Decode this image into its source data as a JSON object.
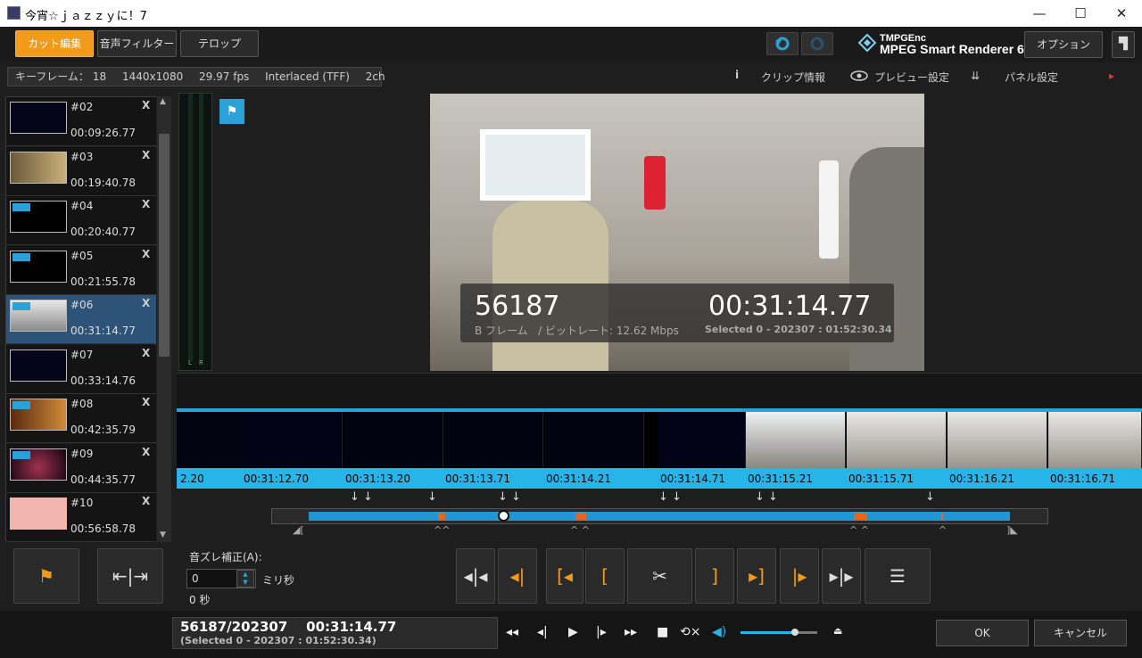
{
  "window": {
    "title": "今宵☆ｊａｚｚｙに！7",
    "minimize": "—",
    "maximize": "☐",
    "close": "✕"
  },
  "tabs": [
    {
      "label": "カット編集"
    },
    {
      "label": "音声フィルター"
    },
    {
      "label": "テロップ"
    }
  ],
  "brand": {
    "line1": "TMPGEnc",
    "line2": "MPEG Smart Renderer 6"
  },
  "options_label": "オプション",
  "info": {
    "keyframe_label": "キーフレーム：",
    "keyframe_value": "18",
    "resolution": "1440x1080",
    "fps": "29.97 fps",
    "scan": "Interlaced (TFF)",
    "audio": "2ch"
  },
  "right_links": {
    "clip_info": "クリップ情報",
    "preview_settings": "プレビュー設定",
    "panel_settings": "パネル設定"
  },
  "clips": [
    {
      "num": "#02",
      "time": "00:09:26.77"
    },
    {
      "num": "#03",
      "time": "00:19:40.78"
    },
    {
      "num": "#04",
      "time": "00:20:40.77"
    },
    {
      "num": "#05",
      "time": "00:21:55.78"
    },
    {
      "num": "#06",
      "time": "00:31:14.77"
    },
    {
      "num": "#07",
      "time": "00:33:14.76"
    },
    {
      "num": "#08",
      "time": "00:42:35.79"
    },
    {
      "num": "#09",
      "time": "00:44:35.77"
    },
    {
      "num": "#10",
      "time": "00:56:58.78"
    }
  ],
  "clip_remove": "X",
  "overlay": {
    "frame": "56187",
    "frame_type": "B フレーム",
    "bitrate": "/ ビットレート: 12.62 Mbps",
    "time": "00:31:14.77",
    "selected": "Selected 0 - 202307 : 01:52:30.34"
  },
  "meter_labels": {
    "l": "L",
    "r": "R"
  },
  "filmstrip_timecodes": [
    "2.20",
    "00:31:12.70",
    "00:31:13.20",
    "00:31:13.71",
    "00:31:14.21",
    "00:31:14.71",
    "00:31:15.21",
    "00:31:15.71",
    "00:31:16.21",
    "00:31:16.71"
  ],
  "audio_sync": {
    "label": "音ズレ補正(A):",
    "value": "0",
    "unit": "ミリ秒",
    "seconds": "0 秒"
  },
  "status": {
    "line1": "56187/202307    00:31:14.77",
    "line2": "(Selected 0 - 202307 : 01:52:30.34)"
  },
  "volume": 0.72,
  "buttons": {
    "ok": "OK",
    "cancel": "キャンセル"
  },
  "colors": {
    "accent": "#f29a1a",
    "blue": "#27b4e8",
    "cut_marker": "#e8651e"
  }
}
